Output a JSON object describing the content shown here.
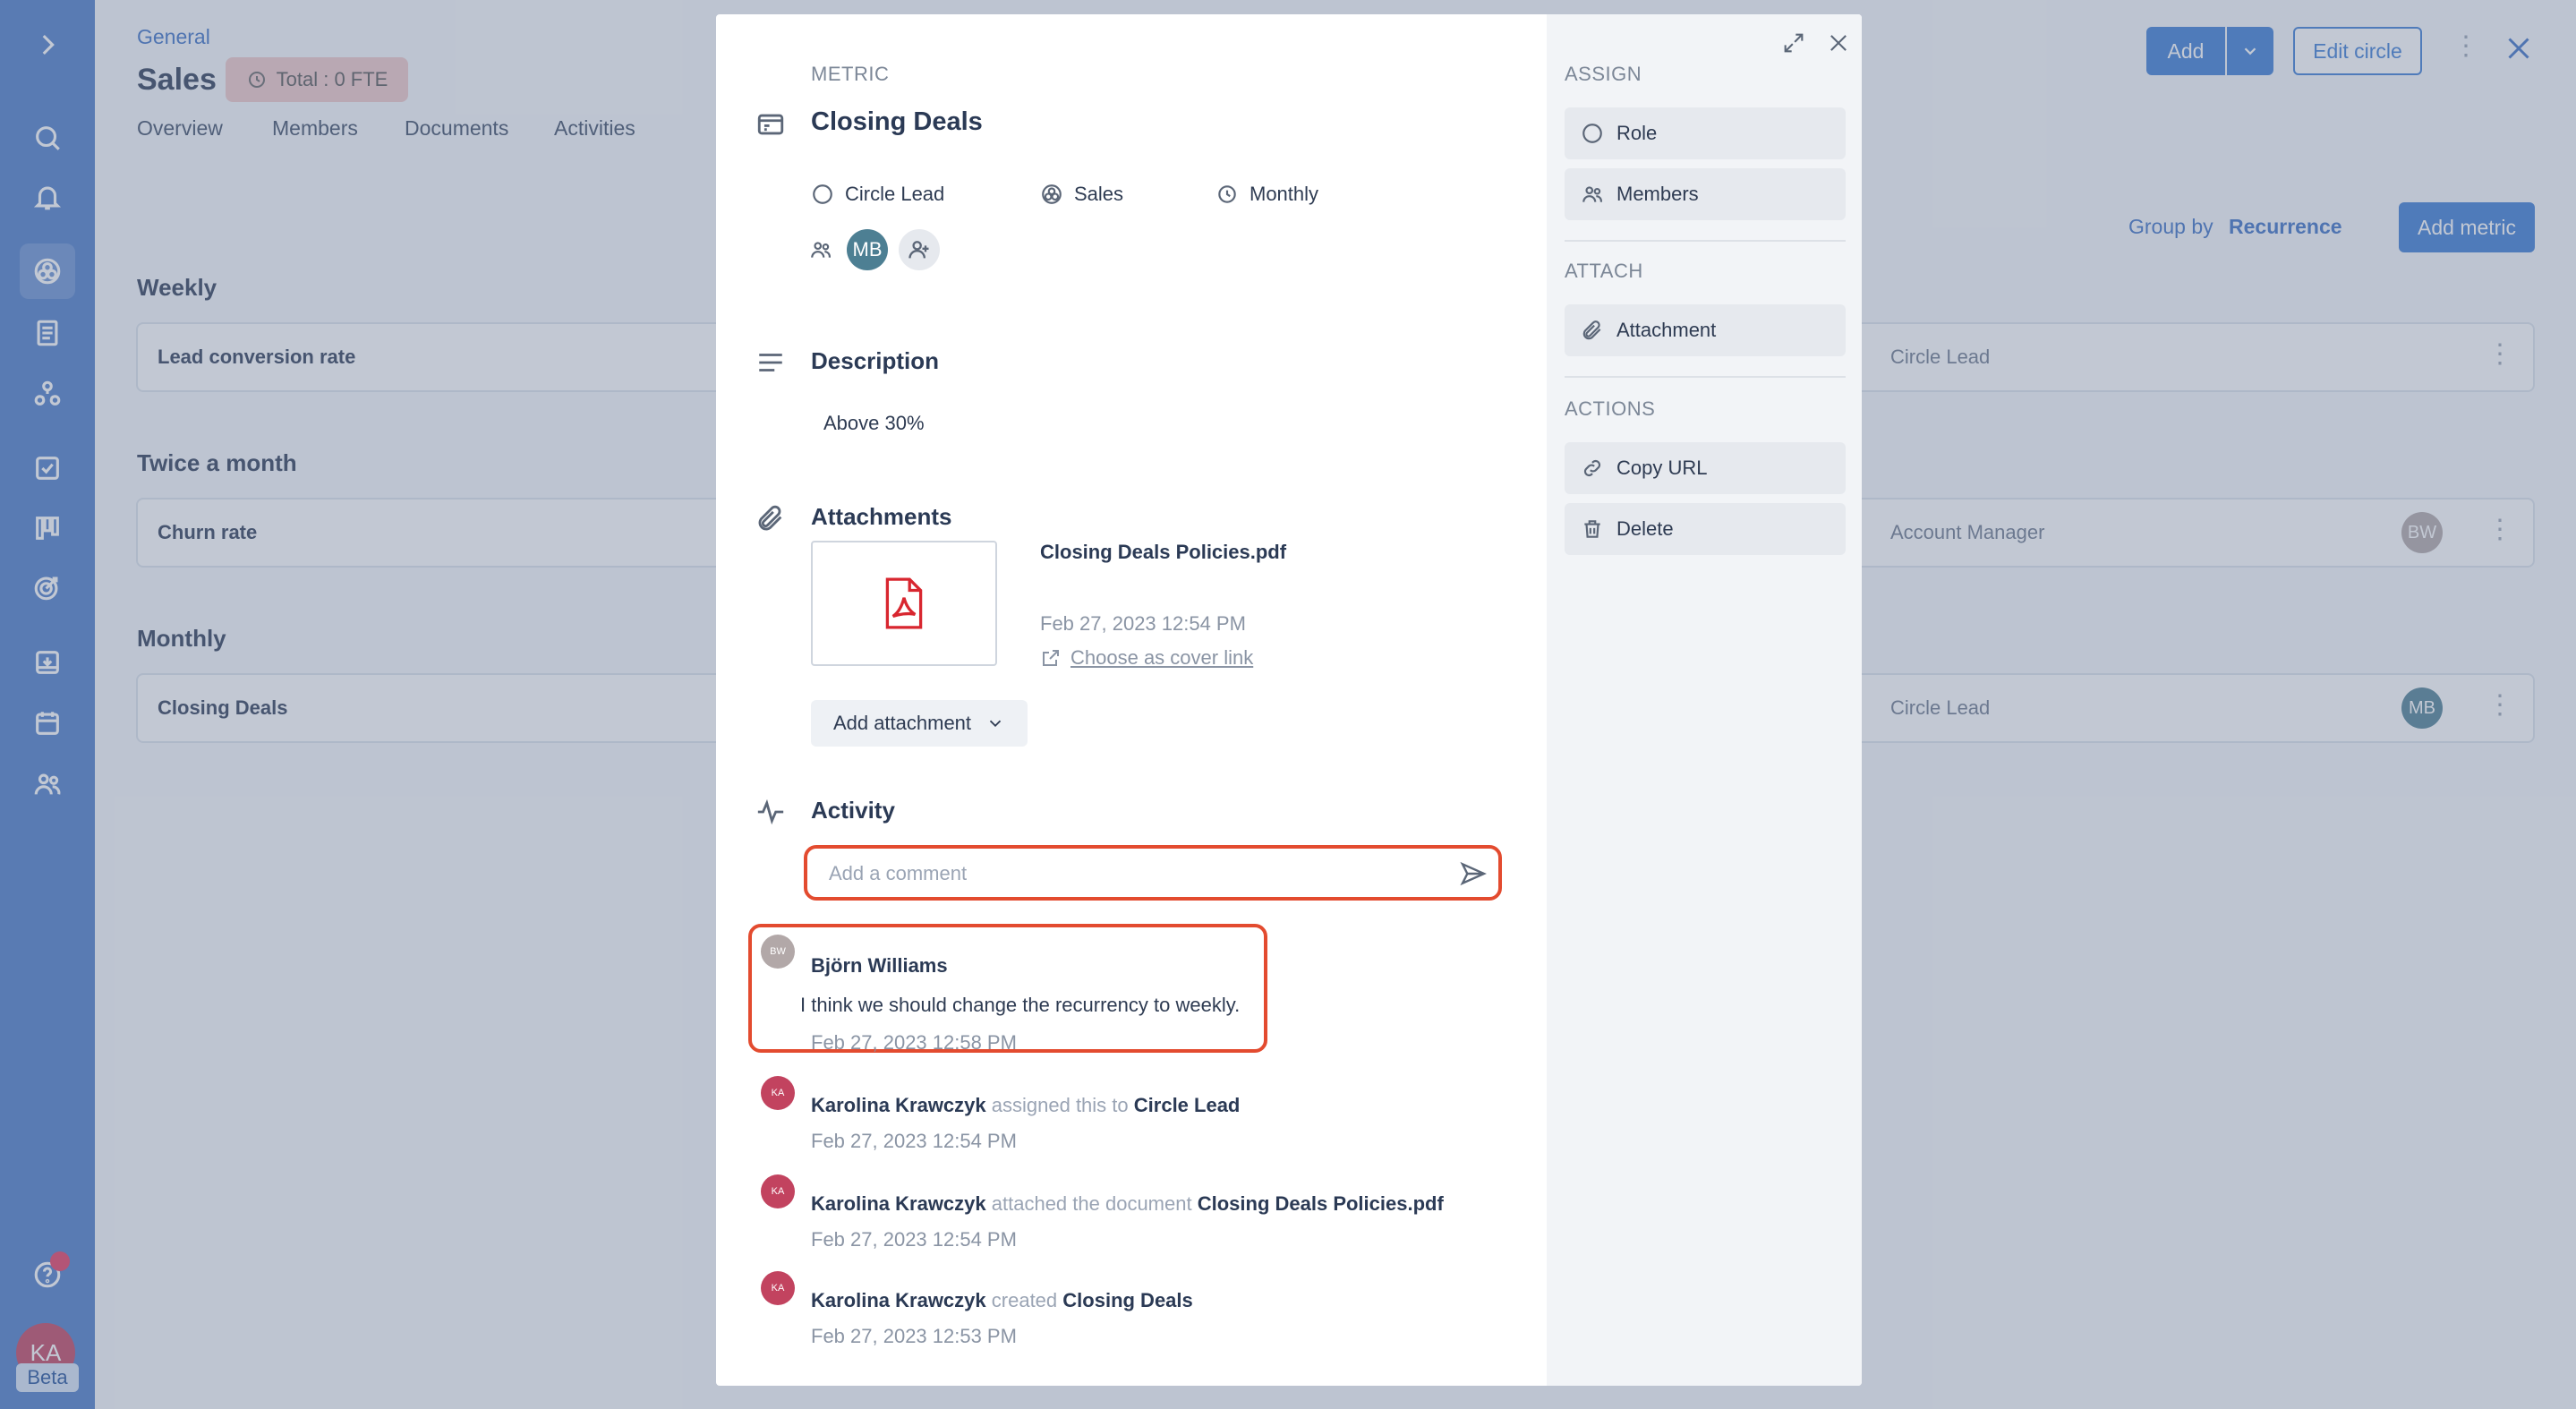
{
  "page": {
    "breadcrumb": "General",
    "title": "Sales",
    "fte_badge": "Total : 0 FTE",
    "tabs": [
      "Overview",
      "Members",
      "Documents",
      "Activities"
    ],
    "add_button": "Add",
    "edit_circle_button": "Edit circle",
    "group_by_label": "Group by",
    "group_by_value": "Recurrence",
    "add_metric_button": "Add metric",
    "sections": [
      {
        "heading": "Weekly",
        "rows": [
          {
            "title": "Lead conversion rate",
            "role": "Circle Lead",
            "avatar": ""
          }
        ]
      },
      {
        "heading": "Twice a month",
        "rows": [
          {
            "title": "Churn rate",
            "role": "Account Manager",
            "avatar": "BW"
          }
        ]
      },
      {
        "heading": "Monthly",
        "rows": [
          {
            "title": "Closing Deals",
            "role": "Circle Lead",
            "avatar": "MB"
          }
        ]
      }
    ]
  },
  "rail": {
    "user_initials": "KA",
    "beta_label": "Beta"
  },
  "modal": {
    "type_label": "METRIC",
    "title": "Closing Deals",
    "meta": {
      "role": "Circle Lead",
      "circle": "Sales",
      "recurrence": "Monthly"
    },
    "assignee_initials": "MB",
    "description_heading": "Description",
    "description_text": "Above 30%",
    "attachments_heading": "Attachments",
    "attachment": {
      "name": "Closing Deals Policies.pdf",
      "date": "Feb 27, 2023 12:54 PM",
      "cover_link": "Choose as cover link"
    },
    "add_attachment_button": "Add attachment",
    "activity_heading": "Activity",
    "comment_placeholder": "Add a comment",
    "comment": {
      "initials": "BW",
      "author": "Björn Williams",
      "text": "I think we should change the recurrency to weekly.",
      "date": "Feb 27, 2023 12:58 PM"
    },
    "activities": [
      {
        "initials": "KA",
        "actor": "Karolina Krawczyk",
        "verb": "assigned this to",
        "object": "Circle Lead",
        "date": "Feb 27, 2023 12:54 PM"
      },
      {
        "initials": "KA",
        "actor": "Karolina Krawczyk",
        "verb": "attached the document",
        "object": "Closing Deals Policies.pdf",
        "date": "Feb 27, 2023 12:54 PM"
      },
      {
        "initials": "KA",
        "actor": "Karolina Krawczyk",
        "verb": "created",
        "object": "Closing Deals",
        "date": "Feb 27, 2023 12:53 PM"
      }
    ],
    "sidebar": {
      "assign_label": "ASSIGN",
      "role_button": "Role",
      "members_button": "Members",
      "attach_label": "ATTACH",
      "attachment_button": "Attachment",
      "actions_label": "ACTIONS",
      "copy_url_button": "Copy URL",
      "delete_button": "Delete"
    }
  },
  "colors": {
    "accent": "#3a7bd5",
    "rail": "#4a7bc9",
    "highlight": "#e34b2f",
    "ka_avatar": "#c2435f",
    "mb_avatar": "#4d7f93",
    "bw_avatar": "#b2a8a8"
  }
}
